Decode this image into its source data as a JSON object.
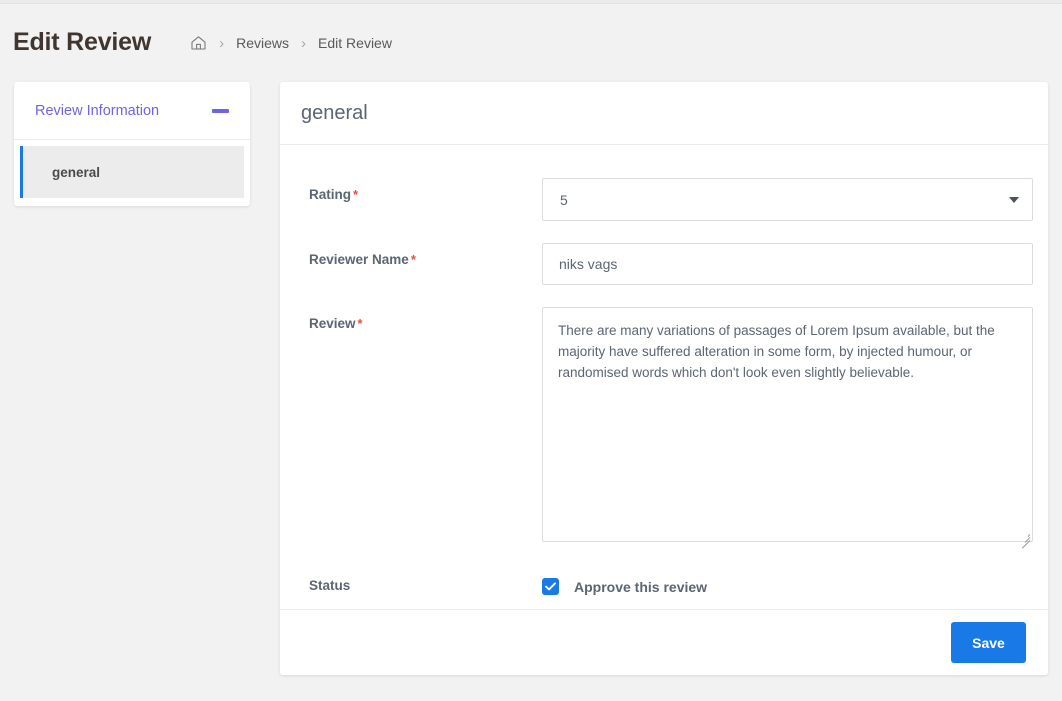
{
  "header": {
    "title": "Edit Review",
    "breadcrumb": {
      "home_icon": "home-icon",
      "separator": "›",
      "items": [
        {
          "label": "Reviews"
        },
        {
          "label": "Edit Review"
        }
      ]
    }
  },
  "sidebar": {
    "section_title": "Review Information",
    "collapse_icon": "minus-icon",
    "items": [
      {
        "label": "general",
        "active": true
      }
    ]
  },
  "main": {
    "card_title": "general",
    "fields": {
      "rating": {
        "label": "Rating",
        "required_marker": "*",
        "value": "5",
        "arrow_icon": "chevron-down-icon"
      },
      "reviewer_name": {
        "label": "Reviewer Name",
        "required_marker": "*",
        "value": "niks vags",
        "placeholder": ""
      },
      "review": {
        "label": "Review",
        "required_marker": "*",
        "value": "There are many variations of passages of Lorem Ipsum available, but the majority have suffered alteration in some form, by injected humour, or randomised words which don't look even slightly believable.",
        "placeholder": ""
      },
      "status": {
        "label": "Status",
        "checkbox_label": "Approve this review",
        "checked": true
      }
    },
    "footer": {
      "save_label": "Save"
    }
  },
  "colors": {
    "accent_blue": "#1979e6",
    "accent_purple": "#6e63e8",
    "required_red": "#e8503a",
    "label_slate": "#5b6573",
    "page_background": "#f2f2f2"
  }
}
